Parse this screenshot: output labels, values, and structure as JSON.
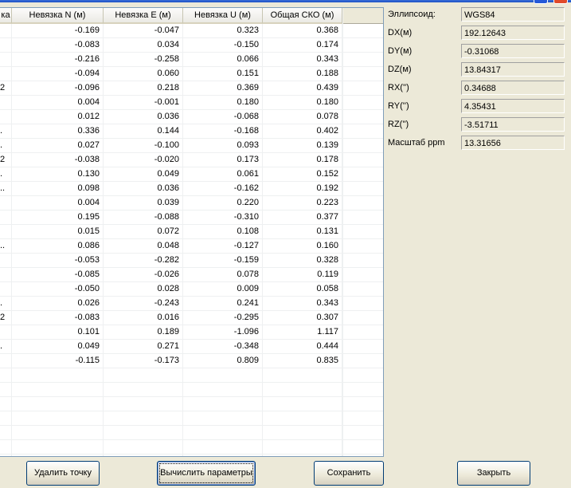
{
  "table": {
    "columns": [
      "ка",
      "Невязка N (м)",
      "Невязка E (м)",
      "Невязка U (м)",
      "Общая СКО (м)"
    ],
    "rows": [
      [
        "",
        "-0.169",
        "-0.047",
        "0.323",
        "0.368"
      ],
      [
        "",
        "-0.083",
        "0.034",
        "-0.150",
        "0.174"
      ],
      [
        "",
        "-0.216",
        "-0.258",
        "0.066",
        "0.343"
      ],
      [
        "",
        "-0.094",
        "0.060",
        "0.151",
        "0.188"
      ],
      [
        "2",
        "-0.096",
        "0.218",
        "0.369",
        "0.439"
      ],
      [
        "",
        "0.004",
        "-0.001",
        "0.180",
        "0.180"
      ],
      [
        "",
        "0.012",
        "0.036",
        "-0.068",
        "0.078"
      ],
      [
        ".",
        "0.336",
        "0.144",
        "-0.168",
        "0.402"
      ],
      [
        ".",
        "0.027",
        "-0.100",
        "0.093",
        "0.139"
      ],
      [
        "2",
        "-0.038",
        "-0.020",
        "0.173",
        "0.178"
      ],
      [
        ".",
        "0.130",
        "0.049",
        "0.061",
        "0.152"
      ],
      [
        "..",
        "0.098",
        "0.036",
        "-0.162",
        "0.192"
      ],
      [
        "",
        "0.004",
        "0.039",
        "0.220",
        "0.223"
      ],
      [
        "",
        "0.195",
        "-0.088",
        "-0.310",
        "0.377"
      ],
      [
        "",
        "0.015",
        "0.072",
        "0.108",
        "0.131"
      ],
      [
        "..",
        "0.086",
        "0.048",
        "-0.127",
        "0.160"
      ],
      [
        "",
        "-0.053",
        "-0.282",
        "-0.159",
        "0.328"
      ],
      [
        "",
        "-0.085",
        "-0.026",
        "0.078",
        "0.119"
      ],
      [
        "",
        "-0.050",
        "0.028",
        "0.009",
        "0.058"
      ],
      [
        ".",
        "0.026",
        "-0.243",
        "0.241",
        "0.343"
      ],
      [
        "2",
        "-0.083",
        "0.016",
        "-0.295",
        "0.307"
      ],
      [
        "",
        "0.101",
        "0.189",
        "-1.096",
        "1.117"
      ],
      [
        ".",
        "0.049",
        "0.271",
        "-0.348",
        "0.444"
      ],
      [
        "",
        "-0.115",
        "-0.173",
        "0.809",
        "0.835"
      ]
    ],
    "empty_rows": 8
  },
  "params": [
    {
      "label": "Эллипсоид:",
      "value": "WGS84"
    },
    {
      "label": "DX(м)",
      "value": "192.12643"
    },
    {
      "label": "DY(м)",
      "value": "-0.31068"
    },
    {
      "label": "DZ(м)",
      "value": "13.84317"
    },
    {
      "label": "RX('')",
      "value": "0.34688"
    },
    {
      "label": "RY('')",
      "value": "4.35431"
    },
    {
      "label": "RZ('')",
      "value": "-3.51711"
    },
    {
      "label": "Масштаб ppm",
      "value": "13.31656"
    }
  ],
  "buttons": {
    "delete": "Удалить точку",
    "compute": "Вычислить параметры",
    "save": "Сохранить",
    "close": "Закрыть"
  },
  "colors": {
    "title_blue": "#1c4fc4",
    "face": "#ece9d8",
    "border_blue": "#003c74"
  }
}
